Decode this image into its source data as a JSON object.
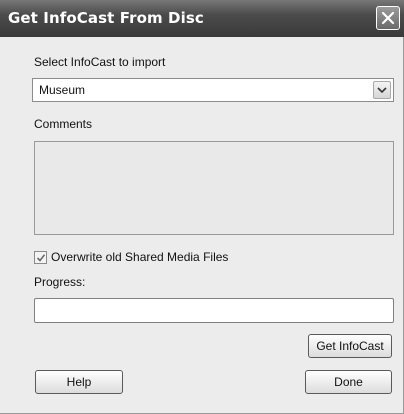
{
  "window": {
    "title": "Get InfoCast From Disc"
  },
  "select_section": {
    "label": "Select InfoCast to import",
    "selected_value": "Museum"
  },
  "comments": {
    "label": "Comments",
    "value": ""
  },
  "overwrite": {
    "label": "Overwrite old Shared Media Files",
    "checked": true
  },
  "progress": {
    "label": "Progress:",
    "value": ""
  },
  "buttons": {
    "get_infocast": "Get InfoCast",
    "help": "Help",
    "done": "Done"
  },
  "icons": {
    "close": "close-icon",
    "dropdown": "chevron-down-icon",
    "check": "checkmark-icon"
  }
}
